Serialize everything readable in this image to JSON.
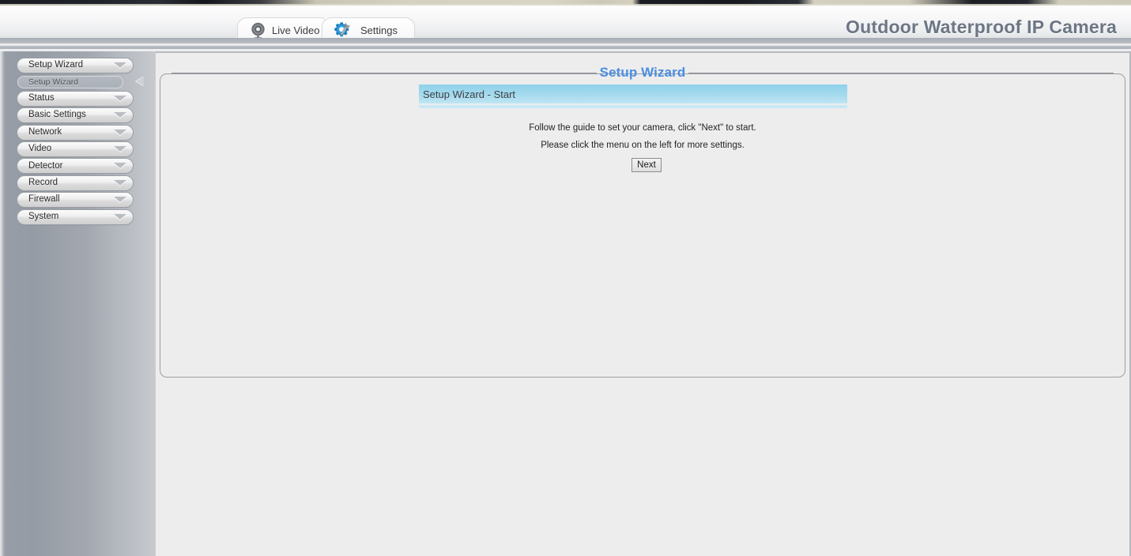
{
  "app": {
    "title": "Outdoor Waterproof IP Camera"
  },
  "tabs": [
    {
      "label": "Live Video",
      "icon": "camera-icon",
      "active": false
    },
    {
      "label": "Settings",
      "icon": "gear-wrench-icon",
      "active": true
    }
  ],
  "sidebar": {
    "items": [
      {
        "label": "Setup Wizard",
        "icon": "chevron-down-icon",
        "expanded": true
      },
      {
        "label": "Status",
        "icon": "chevron-down-icon",
        "expanded": false
      },
      {
        "label": "Basic Settings",
        "icon": "chevron-down-icon",
        "expanded": false
      },
      {
        "label": "Network",
        "icon": "chevron-down-icon",
        "expanded": false
      },
      {
        "label": "Video",
        "icon": "chevron-down-icon",
        "expanded": false
      },
      {
        "label": "Detector",
        "icon": "chevron-down-icon",
        "expanded": false
      },
      {
        "label": "Record",
        "icon": "chevron-down-icon",
        "expanded": false
      },
      {
        "label": "Firewall",
        "icon": "chevron-down-icon",
        "expanded": false
      },
      {
        "label": "System",
        "icon": "chevron-down-icon",
        "expanded": false
      }
    ],
    "submenu": {
      "label": "Setup Wizard",
      "marker_icon": "arrow-left-icon",
      "selected": true
    }
  },
  "main": {
    "card_title": "Setup Wizard",
    "section_header": "Setup Wizard - Start",
    "line1": "Follow the guide to set your camera, click \"Next\" to start.",
    "line2": "Please click the menu on the left for more settings.",
    "next_label": "Next"
  },
  "colors": {
    "accent_blue": "#4a8ee0",
    "section_bar_blue": "#8ed1ea",
    "title_gray": "#6d7684",
    "sidebar_gray": "#989ea7",
    "page_bg": "#ededed"
  }
}
